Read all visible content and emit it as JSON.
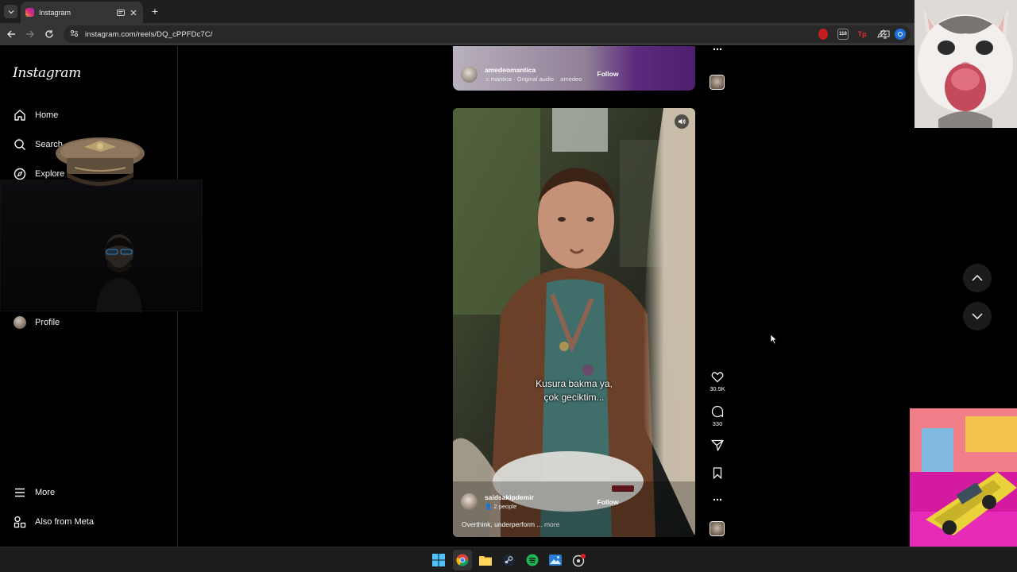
{
  "browser": {
    "tab_title": "Instagram",
    "url": "instagram.com/reels/DQ_cPPFDc7C/",
    "extension_badge": "110",
    "icons": [
      "tab-search-icon",
      "back-icon",
      "forward-icon",
      "reload-icon",
      "site-info-icon",
      "cast-icon",
      "bookmark-star-icon"
    ]
  },
  "sidebar": {
    "logo": "Instagram",
    "items": [
      {
        "label": "Home",
        "icon": "home-icon"
      },
      {
        "label": "Search",
        "icon": "search-icon"
      },
      {
        "label": "Explore",
        "icon": "compass-icon"
      },
      {
        "label": "Profile",
        "icon": "avatar"
      },
      {
        "label": "More",
        "icon": "menu-icon"
      },
      {
        "label": "Also from Meta",
        "icon": "meta-apps-icon"
      }
    ]
  },
  "reels": {
    "top": {
      "username": "amedeomantica",
      "audio": "mantica · Original audio",
      "audio_trail": "amedeo",
      "follow": "Follow"
    },
    "current": {
      "subtitle_line1": "Kusura bakma ya,",
      "subtitle_line2": "çok geciktim...",
      "username": "saidsakipdemir",
      "collab": "2 people",
      "follow": "Follow",
      "caption": "Overthink, underperform ...",
      "caption_more": "more",
      "likes": "30.5K",
      "comments": "330"
    }
  },
  "colors": {
    "accent_follow": "#ffffff",
    "page_bg": "#000000",
    "sidebar_border": "#262626"
  }
}
